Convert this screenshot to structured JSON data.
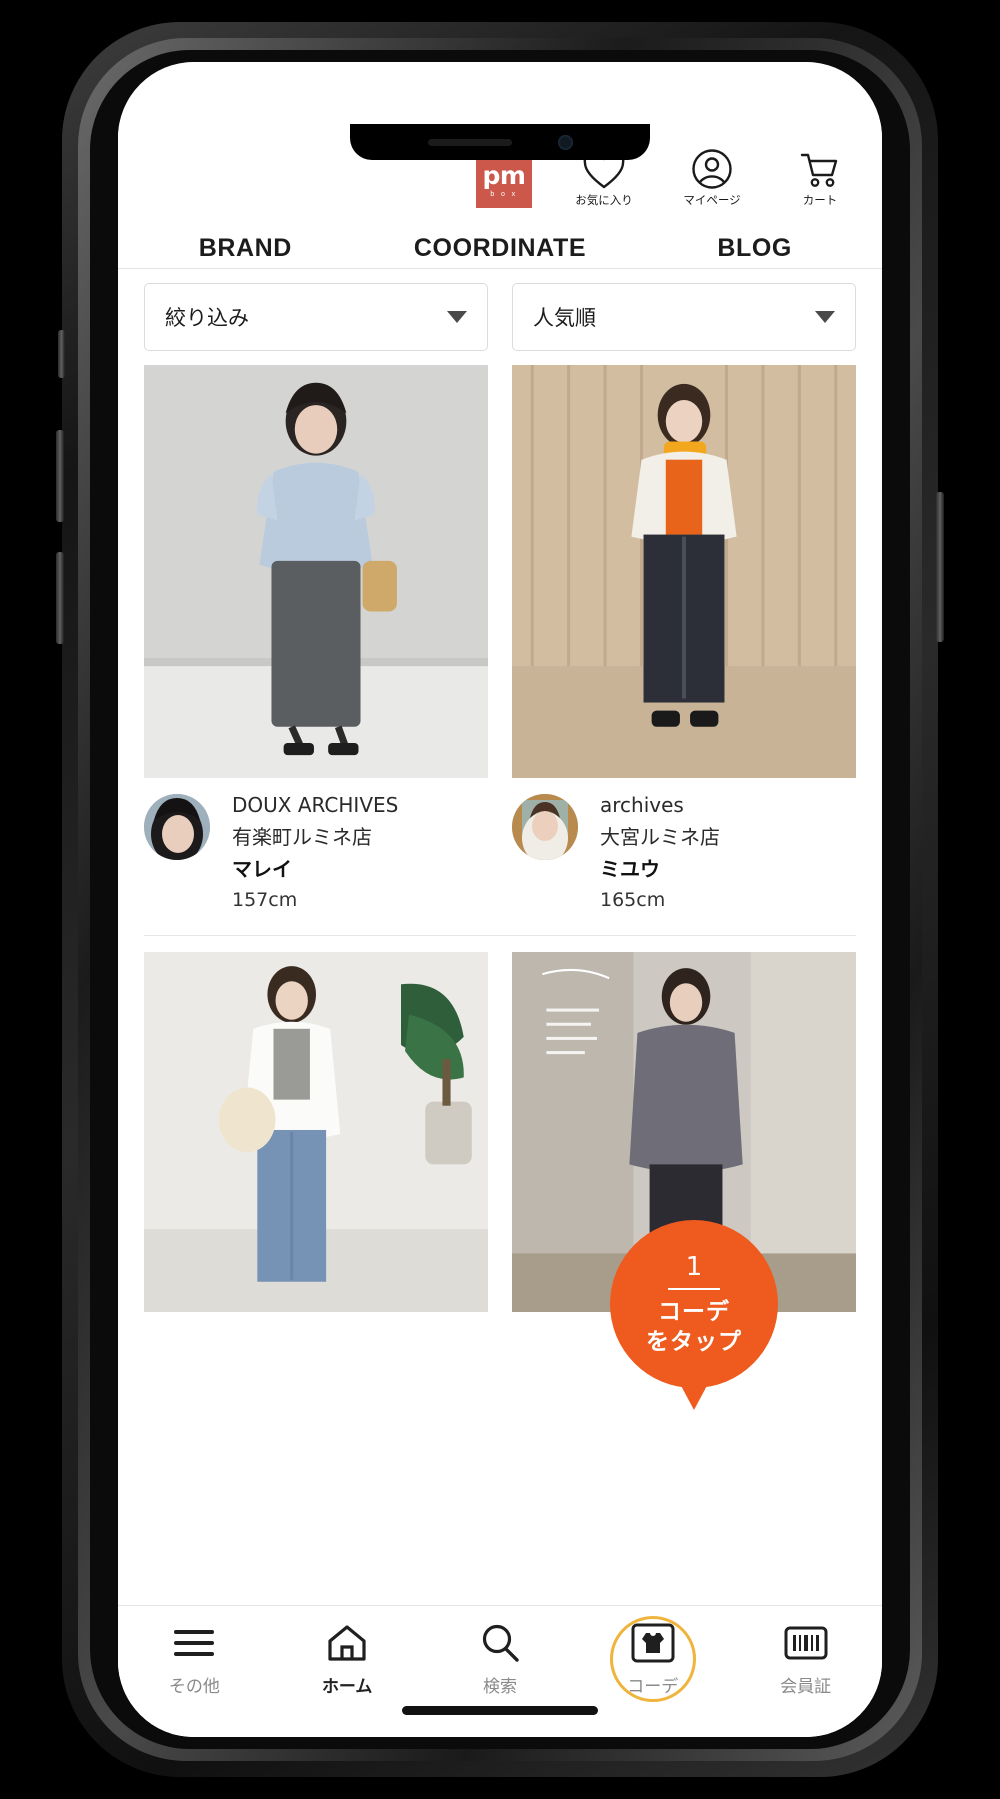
{
  "header": {
    "logo": {
      "main": "pm",
      "sub": "b o x",
      "color": "#cc584b"
    },
    "icons": [
      {
        "name": "favorite-icon",
        "label": "お気に入り"
      },
      {
        "name": "mypage-icon",
        "label": "マイページ"
      },
      {
        "name": "cart-icon",
        "label": "カート"
      }
    ],
    "tabs": [
      {
        "label": "BRAND",
        "active": false
      },
      {
        "label": "COORDINATE",
        "active": true
      },
      {
        "label": "BLOG",
        "active": false
      }
    ],
    "active_tab_color": "#1f6fc0"
  },
  "filters": {
    "refine": {
      "label": "絞り込み",
      "caret": "chevron-down-icon"
    },
    "sort": {
      "label": "人気順",
      "caret": "chevron-down-icon"
    }
  },
  "coordinates": [
    {
      "brand": "DOUX ARCHIVES",
      "store": "有楽町ルミネ店",
      "model": "マレイ",
      "height": "157cm"
    },
    {
      "brand": "archives",
      "store": "大宮ルミネ店",
      "model": "ミユウ",
      "height": "165cm"
    }
  ],
  "callout": {
    "step": "1",
    "line1": "コーデ",
    "line2": "をタップ",
    "color": "#ef5a1e"
  },
  "bottom_nav": {
    "items": [
      {
        "icon": "menu-icon",
        "label": "その他",
        "active": false,
        "highlight": false
      },
      {
        "icon": "home-icon",
        "label": "ホーム",
        "active": true,
        "highlight": false
      },
      {
        "icon": "search-icon",
        "label": "検索",
        "active": false,
        "highlight": false
      },
      {
        "icon": "coordinate-shirt-icon",
        "label": "コーデ",
        "active": false,
        "highlight": true
      },
      {
        "icon": "membership-card-icon",
        "label": "会員証",
        "active": false,
        "highlight": false
      }
    ],
    "highlight_ring_color": "#f0b43c"
  }
}
